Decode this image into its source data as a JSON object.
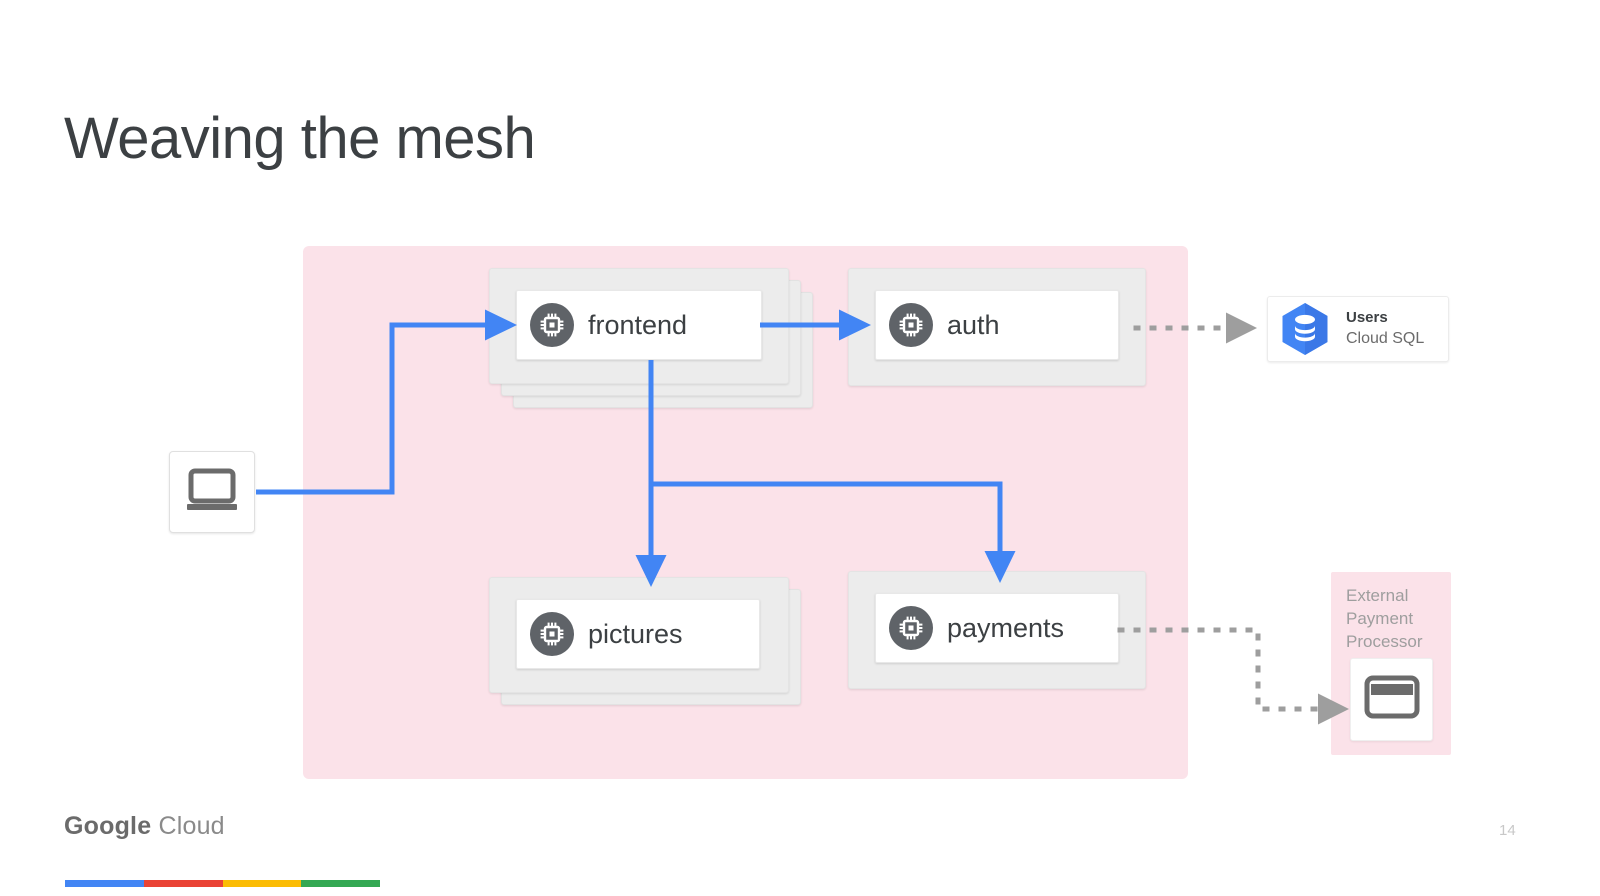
{
  "slide": {
    "title": "Weaving the mesh",
    "page_number": "14",
    "footer_brand_google": "Google",
    "footer_brand_cloud": " Cloud",
    "mesh_region_color": "#fbe2e9",
    "accent_blue": "#4285F4",
    "dotted_gray": "#9e9e9e"
  },
  "client": {
    "icon": "laptop-icon"
  },
  "services": [
    {
      "id": "frontend",
      "label": "frontend",
      "icon": "chip-icon",
      "stacked": true,
      "stack_count": 3
    },
    {
      "id": "auth",
      "label": "auth",
      "icon": "chip-icon",
      "stacked": false,
      "stack_count": 1
    },
    {
      "id": "pictures",
      "label": "pictures",
      "icon": "chip-icon",
      "stacked": true,
      "stack_count": 2
    },
    {
      "id": "payments",
      "label": "payments",
      "icon": "chip-icon",
      "stacked": false,
      "stack_count": 1
    }
  ],
  "external": {
    "cloudsql": {
      "title": "Users",
      "subtitle": "Cloud SQL",
      "icon": "cloud-sql-hexagon-icon",
      "hex_color": "#4285F4"
    },
    "payment_processor": {
      "label": "External Payment Processor",
      "icon": "credit-card-icon"
    }
  },
  "brand_bar": {
    "colors": [
      "#4285F4",
      "#EA4335",
      "#FBBC04",
      "#34A853"
    ]
  }
}
